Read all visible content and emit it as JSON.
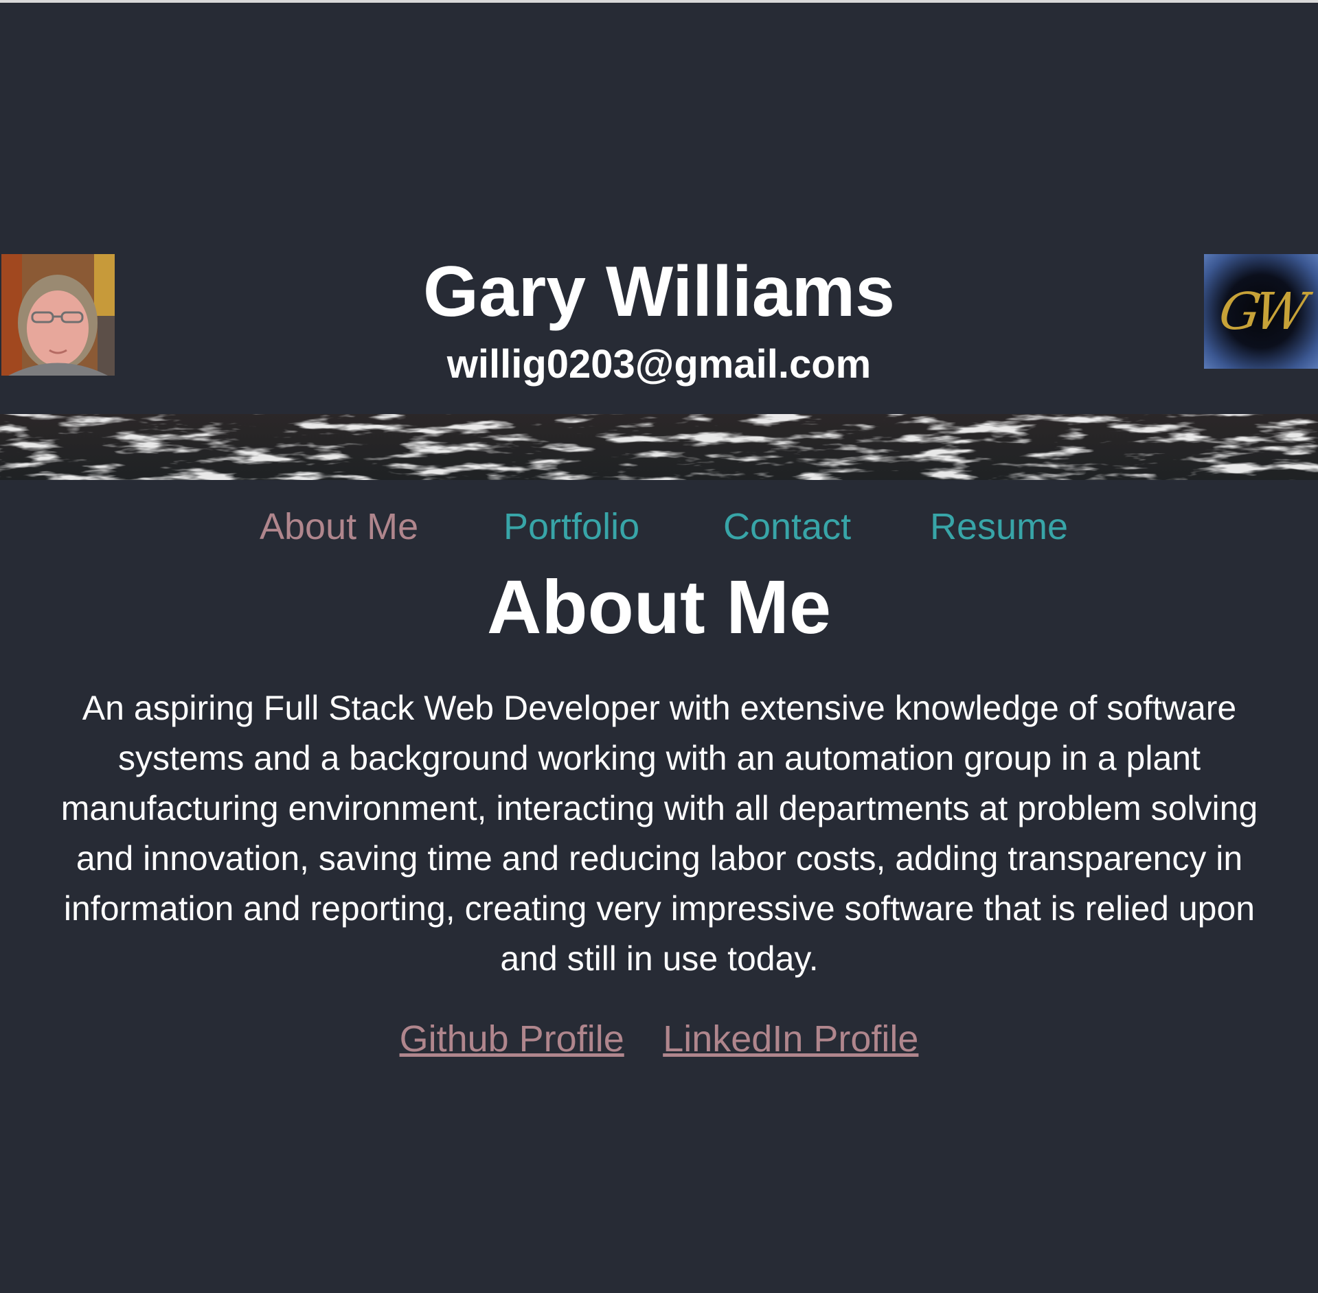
{
  "header": {
    "name": "Gary Williams",
    "email": "willig0203@gmail.com",
    "logo_text": "GW"
  },
  "nav": {
    "items": [
      {
        "label": "About Me",
        "active": true
      },
      {
        "label": "Portfolio",
        "active": false
      },
      {
        "label": "Contact",
        "active": false
      },
      {
        "label": "Resume",
        "active": false
      }
    ]
  },
  "main": {
    "title": "About Me",
    "bio": "An aspiring Full Stack Web Developer with extensive knowledge of software systems and a background working with an automation group in a plant manufacturing environment, interacting with all departments at problem solving and innovation, saving time and reducing labor costs, adding transparency in information and reporting, creating very impressive software that is relied upon and still in use today.",
    "links": [
      {
        "label": "Github Profile"
      },
      {
        "label": "LinkedIn Profile"
      }
    ]
  },
  "colors": {
    "background": "#272b35",
    "nav_link": "#38a5a8",
    "active_link": "#b0868d",
    "text": "#ffffff",
    "logo_gold": "#c7a238"
  }
}
